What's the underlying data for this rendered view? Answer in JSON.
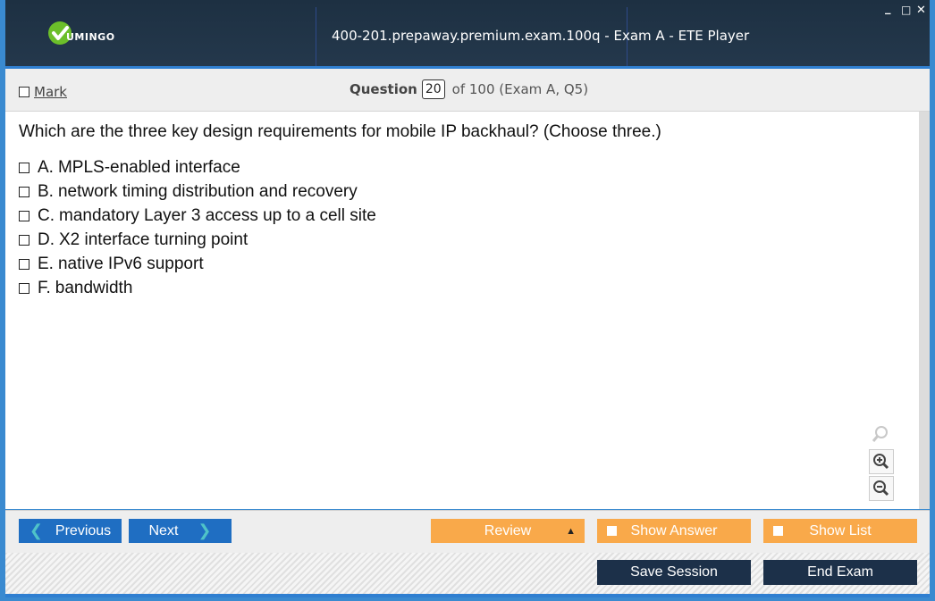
{
  "window": {
    "title": "400-201.prepaway.premium.exam.100q - Exam A - ETE Player",
    "logo_text": "UMINGO",
    "minimize": "_",
    "maximize": "□",
    "close": "✕"
  },
  "toolbar": {
    "mark_label": "Mark",
    "question_label": "Question",
    "question_number": "20",
    "question_of": "of 100 (Exam A, Q5)"
  },
  "question": {
    "text": "Which are the three key design requirements for mobile IP backhaul? (Choose three.)",
    "options": [
      {
        "letter": "A.",
        "text": "MPLS-enabled interface"
      },
      {
        "letter": "B.",
        "text": "network timing distribution and recovery"
      },
      {
        "letter": "C.",
        "text": "mandatory Layer 3 access up to a cell site"
      },
      {
        "letter": "D.",
        "text": "X2 interface turning point"
      },
      {
        "letter": "E.",
        "text": "native IPv6 support"
      },
      {
        "letter": "F.",
        "text": "bandwidth"
      }
    ]
  },
  "zoom": {
    "icons": [
      "magnifier-icon",
      "zoom-in-icon",
      "zoom-out-icon"
    ]
  },
  "nav": {
    "previous_label": "Previous",
    "next_label": "Next",
    "review_label": "Review",
    "show_answer_label": "Show Answer",
    "show_list_label": "Show List",
    "save_session_label": "Save Session",
    "end_exam_label": "End Exam"
  },
  "colors": {
    "titlebar": "#1d3042",
    "accent_blue": "#1f6ec2",
    "accent_orange": "#f9a94a",
    "dark_button": "#1c3049",
    "logo_green": "#6cbf2a"
  }
}
